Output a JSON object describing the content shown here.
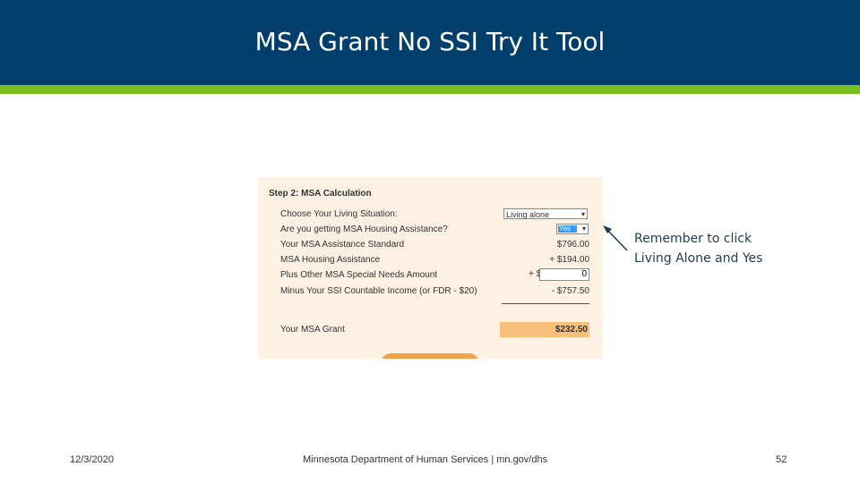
{
  "slide": {
    "title": "MSA Grant No SSI Try It Tool",
    "note": "Remember to click Living Alone and Yes"
  },
  "screenshot": {
    "step_title": "Step 2: MSA Calculation",
    "rows": [
      {
        "label": "Choose Your Living Situation:"
      },
      {
        "label": "Are you getting MSA Housing Assistance?"
      },
      {
        "label": "Your MSA Assistance Standard",
        "value": "$796.00"
      },
      {
        "label": "MSA Housing Assistance",
        "value": "+ $194.00"
      },
      {
        "label": "Plus Other MSA Special Needs Amount"
      },
      {
        "label": "Minus Your SSI Countable Income (or FDR - $20)",
        "value": "- $757.50"
      }
    ],
    "living_situation_select": "Living alone",
    "housing_assistance_select": "Yes",
    "special_needs_prefix": "+ $",
    "special_needs_value": "0",
    "grant_label": "Your MSA Grant",
    "grant_value": "$232.50"
  },
  "footer": {
    "date": "12/3/2020",
    "center": "Minnesota Department of Human Services | mn.gov/dhs",
    "page": "52"
  },
  "colors": {
    "header": "#003e6b",
    "stripe": "#78be20",
    "panel": "#fdf1e3",
    "grant_highlight": "#f9c07c"
  }
}
